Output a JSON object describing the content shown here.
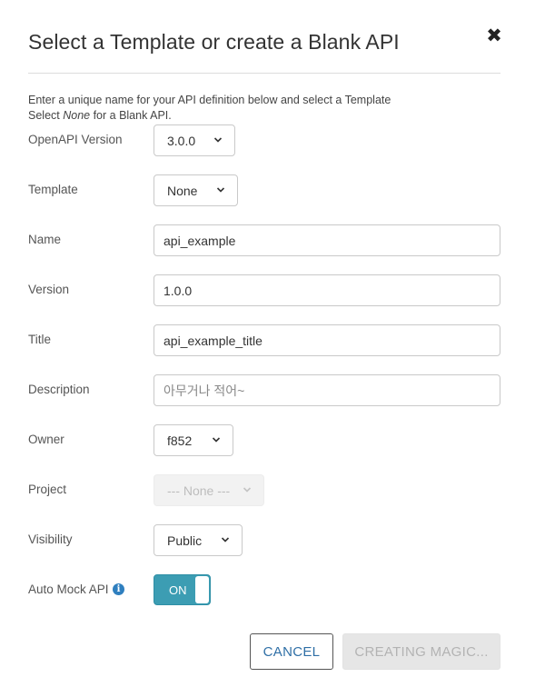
{
  "dialog": {
    "title": "Select a Template or create a Blank API",
    "intro_line1": "Enter a unique name for your API definition below and select a Template",
    "intro_select": "Select ",
    "intro_none": "None",
    "intro_rest": " for a Blank API."
  },
  "fields": {
    "openapi_version": {
      "label": "OpenAPI Version",
      "value": "3.0.0"
    },
    "template": {
      "label": "Template",
      "value": "None"
    },
    "name": {
      "label": "Name",
      "value": "api_example"
    },
    "version": {
      "label": "Version",
      "value": "1.0.0"
    },
    "title": {
      "label": "Title",
      "value": "api_example_title"
    },
    "description": {
      "label": "Description",
      "value": "",
      "placeholder": "아무거나 적어~"
    },
    "owner": {
      "label": "Owner",
      "value": "f852"
    },
    "project": {
      "label": "Project",
      "value": "--- None ---",
      "disabled": true
    },
    "visibility": {
      "label": "Visibility",
      "value": "Public"
    },
    "auto_mock": {
      "label": "Auto Mock API",
      "state": "ON",
      "info_icon": "info-circle-icon"
    }
  },
  "buttons": {
    "cancel": "CANCEL",
    "create": "CREATING MAGIC..."
  },
  "colors": {
    "toggle_on": "#3c9db3",
    "link_blue": "#2f6fa6",
    "info_blue": "#2f7fbf"
  }
}
